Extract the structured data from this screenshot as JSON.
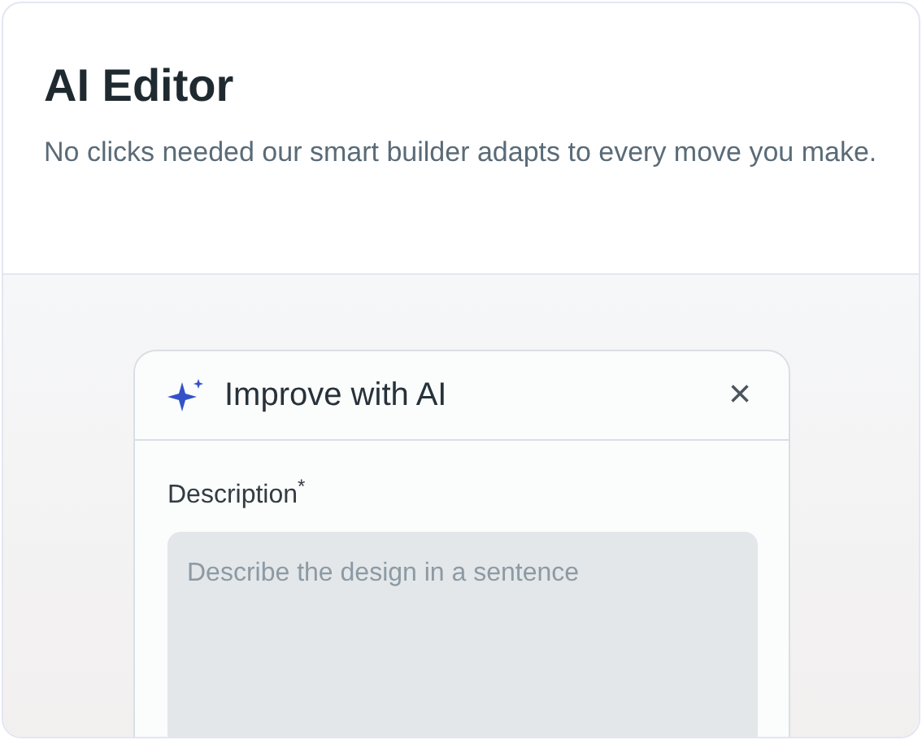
{
  "card": {
    "title": "AI Editor",
    "description": "No clicks needed our smart builder adapts to every move you make."
  },
  "dialog": {
    "title": "Improve with AI",
    "close": "×",
    "field": {
      "label": "Description$^{*}$",
      "placeholder": "Describe the design in a sentence"
    }
  }
}
